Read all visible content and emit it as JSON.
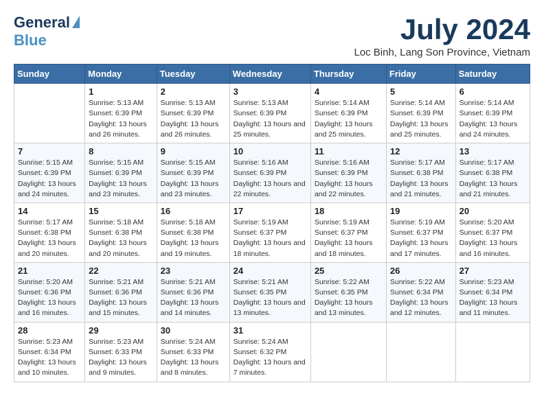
{
  "header": {
    "logo_line1": "General",
    "logo_line2": "Blue",
    "month_title": "July 2024",
    "location": "Loc Binh, Lang Son Province, Vietnam"
  },
  "weekdays": [
    "Sunday",
    "Monday",
    "Tuesday",
    "Wednesday",
    "Thursday",
    "Friday",
    "Saturday"
  ],
  "weeks": [
    [
      {
        "day": "",
        "sunrise": "",
        "sunset": "",
        "daylight": ""
      },
      {
        "day": "1",
        "sunrise": "Sunrise: 5:13 AM",
        "sunset": "Sunset: 6:39 PM",
        "daylight": "Daylight: 13 hours and 26 minutes."
      },
      {
        "day": "2",
        "sunrise": "Sunrise: 5:13 AM",
        "sunset": "Sunset: 6:39 PM",
        "daylight": "Daylight: 13 hours and 26 minutes."
      },
      {
        "day": "3",
        "sunrise": "Sunrise: 5:13 AM",
        "sunset": "Sunset: 6:39 PM",
        "daylight": "Daylight: 13 hours and 25 minutes."
      },
      {
        "day": "4",
        "sunrise": "Sunrise: 5:14 AM",
        "sunset": "Sunset: 6:39 PM",
        "daylight": "Daylight: 13 hours and 25 minutes."
      },
      {
        "day": "5",
        "sunrise": "Sunrise: 5:14 AM",
        "sunset": "Sunset: 6:39 PM",
        "daylight": "Daylight: 13 hours and 25 minutes."
      },
      {
        "day": "6",
        "sunrise": "Sunrise: 5:14 AM",
        "sunset": "Sunset: 6:39 PM",
        "daylight": "Daylight: 13 hours and 24 minutes."
      }
    ],
    [
      {
        "day": "7",
        "sunrise": "Sunrise: 5:15 AM",
        "sunset": "Sunset: 6:39 PM",
        "daylight": "Daylight: 13 hours and 24 minutes."
      },
      {
        "day": "8",
        "sunrise": "Sunrise: 5:15 AM",
        "sunset": "Sunset: 6:39 PM",
        "daylight": "Daylight: 13 hours and 23 minutes."
      },
      {
        "day": "9",
        "sunrise": "Sunrise: 5:15 AM",
        "sunset": "Sunset: 6:39 PM",
        "daylight": "Daylight: 13 hours and 23 minutes."
      },
      {
        "day": "10",
        "sunrise": "Sunrise: 5:16 AM",
        "sunset": "Sunset: 6:39 PM",
        "daylight": "Daylight: 13 hours and 22 minutes."
      },
      {
        "day": "11",
        "sunrise": "Sunrise: 5:16 AM",
        "sunset": "Sunset: 6:39 PM",
        "daylight": "Daylight: 13 hours and 22 minutes."
      },
      {
        "day": "12",
        "sunrise": "Sunrise: 5:17 AM",
        "sunset": "Sunset: 6:38 PM",
        "daylight": "Daylight: 13 hours and 21 minutes."
      },
      {
        "day": "13",
        "sunrise": "Sunrise: 5:17 AM",
        "sunset": "Sunset: 6:38 PM",
        "daylight": "Daylight: 13 hours and 21 minutes."
      }
    ],
    [
      {
        "day": "14",
        "sunrise": "Sunrise: 5:17 AM",
        "sunset": "Sunset: 6:38 PM",
        "daylight": "Daylight: 13 hours and 20 minutes."
      },
      {
        "day": "15",
        "sunrise": "Sunrise: 5:18 AM",
        "sunset": "Sunset: 6:38 PM",
        "daylight": "Daylight: 13 hours and 20 minutes."
      },
      {
        "day": "16",
        "sunrise": "Sunrise: 5:18 AM",
        "sunset": "Sunset: 6:38 PM",
        "daylight": "Daylight: 13 hours and 19 minutes."
      },
      {
        "day": "17",
        "sunrise": "Sunrise: 5:19 AM",
        "sunset": "Sunset: 6:37 PM",
        "daylight": "Daylight: 13 hours and 18 minutes."
      },
      {
        "day": "18",
        "sunrise": "Sunrise: 5:19 AM",
        "sunset": "Sunset: 6:37 PM",
        "daylight": "Daylight: 13 hours and 18 minutes."
      },
      {
        "day": "19",
        "sunrise": "Sunrise: 5:19 AM",
        "sunset": "Sunset: 6:37 PM",
        "daylight": "Daylight: 13 hours and 17 minutes."
      },
      {
        "day": "20",
        "sunrise": "Sunrise: 5:20 AM",
        "sunset": "Sunset: 6:37 PM",
        "daylight": "Daylight: 13 hours and 16 minutes."
      }
    ],
    [
      {
        "day": "21",
        "sunrise": "Sunrise: 5:20 AM",
        "sunset": "Sunset: 6:36 PM",
        "daylight": "Daylight: 13 hours and 16 minutes."
      },
      {
        "day": "22",
        "sunrise": "Sunrise: 5:21 AM",
        "sunset": "Sunset: 6:36 PM",
        "daylight": "Daylight: 13 hours and 15 minutes."
      },
      {
        "day": "23",
        "sunrise": "Sunrise: 5:21 AM",
        "sunset": "Sunset: 6:36 PM",
        "daylight": "Daylight: 13 hours and 14 minutes."
      },
      {
        "day": "24",
        "sunrise": "Sunrise: 5:21 AM",
        "sunset": "Sunset: 6:35 PM",
        "daylight": "Daylight: 13 hours and 13 minutes."
      },
      {
        "day": "25",
        "sunrise": "Sunrise: 5:22 AM",
        "sunset": "Sunset: 6:35 PM",
        "daylight": "Daylight: 13 hours and 13 minutes."
      },
      {
        "day": "26",
        "sunrise": "Sunrise: 5:22 AM",
        "sunset": "Sunset: 6:34 PM",
        "daylight": "Daylight: 13 hours and 12 minutes."
      },
      {
        "day": "27",
        "sunrise": "Sunrise: 5:23 AM",
        "sunset": "Sunset: 6:34 PM",
        "daylight": "Daylight: 13 hours and 11 minutes."
      }
    ],
    [
      {
        "day": "28",
        "sunrise": "Sunrise: 5:23 AM",
        "sunset": "Sunset: 6:34 PM",
        "daylight": "Daylight: 13 hours and 10 minutes."
      },
      {
        "day": "29",
        "sunrise": "Sunrise: 5:23 AM",
        "sunset": "Sunset: 6:33 PM",
        "daylight": "Daylight: 13 hours and 9 minutes."
      },
      {
        "day": "30",
        "sunrise": "Sunrise: 5:24 AM",
        "sunset": "Sunset: 6:33 PM",
        "daylight": "Daylight: 13 hours and 8 minutes."
      },
      {
        "day": "31",
        "sunrise": "Sunrise: 5:24 AM",
        "sunset": "Sunset: 6:32 PM",
        "daylight": "Daylight: 13 hours and 7 minutes."
      },
      {
        "day": "",
        "sunrise": "",
        "sunset": "",
        "daylight": ""
      },
      {
        "day": "",
        "sunrise": "",
        "sunset": "",
        "daylight": ""
      },
      {
        "day": "",
        "sunrise": "",
        "sunset": "",
        "daylight": ""
      }
    ]
  ]
}
